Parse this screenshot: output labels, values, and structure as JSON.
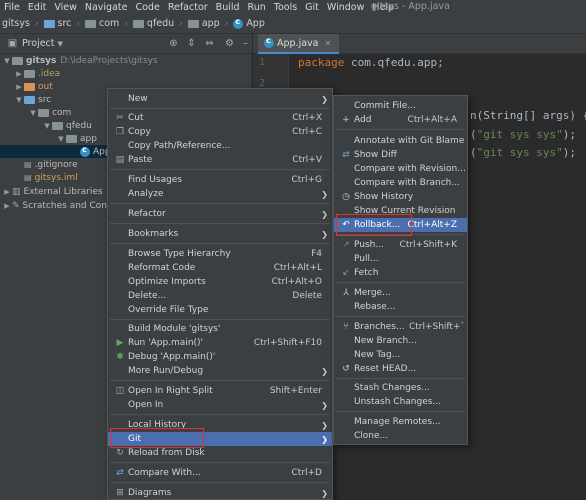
{
  "menubar": {
    "items": [
      "File",
      "Edit",
      "View",
      "Navigate",
      "Code",
      "Refactor",
      "Build",
      "Run",
      "Tools",
      "Git",
      "Window",
      "Help"
    ],
    "window_title": "gitsys - App.java"
  },
  "navbar": {
    "crumbs": [
      "gitsys",
      "src",
      "com",
      "qfedu",
      "app",
      "App"
    ]
  },
  "project_panel": {
    "title": "Project",
    "tree": [
      {
        "label": "gitsys",
        "extra": "D:\\ideaProjects\\gitsys"
      },
      {
        "label": ".idea"
      },
      {
        "label": "out"
      },
      {
        "label": "src"
      },
      {
        "label": "com"
      },
      {
        "label": "qfedu"
      },
      {
        "label": "app"
      },
      {
        "label": "App"
      },
      {
        "label": ".gitignore"
      },
      {
        "label": "gitsys.iml"
      },
      {
        "label": "External Libraries"
      },
      {
        "label": "Scratches and Cons"
      }
    ]
  },
  "editor": {
    "tab": "App.java",
    "line_numbers": [
      "1",
      "2"
    ],
    "code": {
      "line1_kw": "package",
      "line1_rest": " com.qfedu.app;",
      "frag1": "n(String[] args) {",
      "frag2": "(\"git sys sys\");",
      "frag3": "(\"git sys sys\");"
    }
  },
  "context_menu": {
    "items": [
      {
        "label": "New",
        "shortcut": "",
        "submenu": true
      },
      {
        "label": "Cut",
        "shortcut": "Ctrl+X"
      },
      {
        "label": "Copy",
        "shortcut": "Ctrl+C"
      },
      {
        "label": "Copy Path/Reference...",
        "shortcut": ""
      },
      {
        "label": "Paste",
        "shortcut": "Ctrl+V"
      },
      {
        "label": "Find Usages",
        "shortcut": "Ctrl+G"
      },
      {
        "label": "Analyze",
        "shortcut": "",
        "submenu": true
      },
      {
        "label": "Refactor",
        "shortcut": "",
        "submenu": true
      },
      {
        "label": "Bookmarks",
        "shortcut": "",
        "submenu": true
      },
      {
        "label": "Browse Type Hierarchy",
        "shortcut": "F4"
      },
      {
        "label": "Reformat Code",
        "shortcut": "Ctrl+Alt+L"
      },
      {
        "label": "Optimize Imports",
        "shortcut": "Ctrl+Alt+O"
      },
      {
        "label": "Delete...",
        "shortcut": "Delete"
      },
      {
        "label": "Override File Type",
        "shortcut": ""
      },
      {
        "label": "Build Module 'gitsys'",
        "shortcut": ""
      },
      {
        "label": "Run 'App.main()'",
        "shortcut": "Ctrl+Shift+F10"
      },
      {
        "label": "Debug 'App.main()'",
        "shortcut": ""
      },
      {
        "label": "More Run/Debug",
        "shortcut": "",
        "submenu": true
      },
      {
        "label": "Open In Right Split",
        "shortcut": "Shift+Enter"
      },
      {
        "label": "Open In",
        "shortcut": "",
        "submenu": true
      },
      {
        "label": "Local History",
        "shortcut": "",
        "submenu": true
      },
      {
        "label": "Git",
        "shortcut": "",
        "submenu": true
      },
      {
        "label": "Reload from Disk",
        "shortcut": ""
      },
      {
        "label": "Compare With...",
        "shortcut": "Ctrl+D"
      },
      {
        "label": "Diagrams",
        "shortcut": "",
        "submenu": true
      }
    ]
  },
  "git_menu": {
    "items": [
      {
        "label": "Commit File...",
        "shortcut": ""
      },
      {
        "label": "Add",
        "shortcut": "Ctrl+Alt+A"
      },
      {
        "label": "Annotate with Git Blame",
        "shortcut": ""
      },
      {
        "label": "Show Diff",
        "shortcut": ""
      },
      {
        "label": "Compare with Revision...",
        "shortcut": ""
      },
      {
        "label": "Compare with Branch...",
        "shortcut": ""
      },
      {
        "label": "Show History",
        "shortcut": ""
      },
      {
        "label": "Show Current Revision",
        "shortcut": ""
      },
      {
        "label": "Rollback...",
        "shortcut": "Ctrl+Alt+Z"
      },
      {
        "label": "Push...",
        "shortcut": "Ctrl+Shift+K"
      },
      {
        "label": "Pull...",
        "shortcut": ""
      },
      {
        "label": "Fetch",
        "shortcut": ""
      },
      {
        "label": "Merge...",
        "shortcut": ""
      },
      {
        "label": "Rebase...",
        "shortcut": ""
      },
      {
        "label": "Branches...",
        "shortcut": "Ctrl+Shift+`"
      },
      {
        "label": "New Branch...",
        "shortcut": ""
      },
      {
        "label": "New Tag...",
        "shortcut": ""
      },
      {
        "label": "Reset HEAD...",
        "shortcut": ""
      },
      {
        "label": "Stash Changes...",
        "shortcut": ""
      },
      {
        "label": "Unstash Changes...",
        "shortcut": ""
      },
      {
        "label": "Manage Remotes...",
        "shortcut": ""
      },
      {
        "label": "Clone...",
        "shortcut": ""
      }
    ]
  },
  "colors": {
    "highlight": "#4b6eaf",
    "annotation_box": "#e0322f",
    "keyword": "#cc7832",
    "string": "#6a8759"
  }
}
